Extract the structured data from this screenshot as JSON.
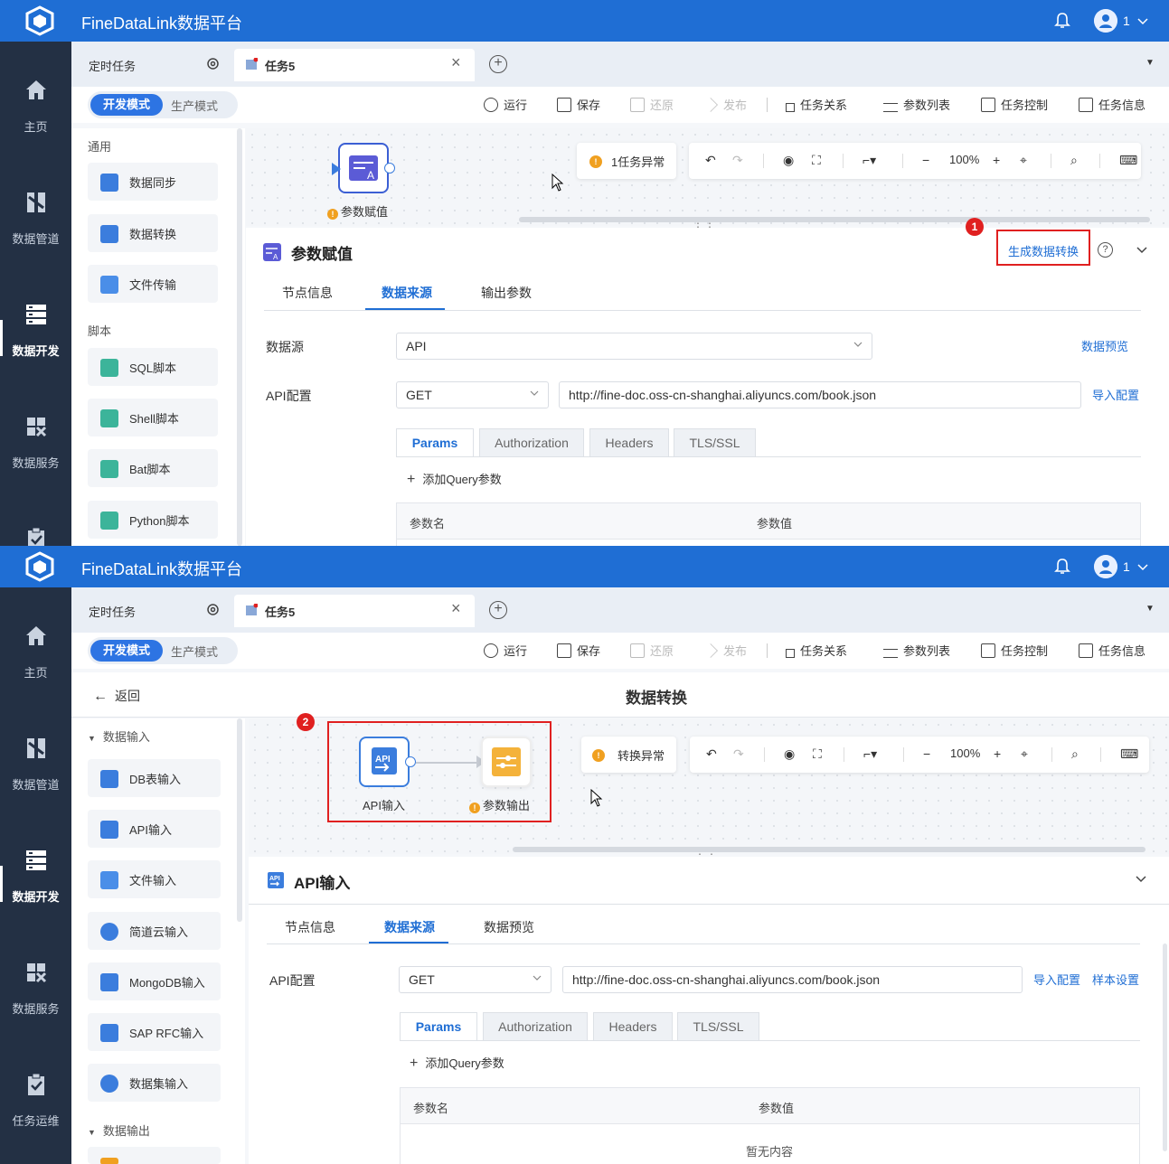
{
  "app": {
    "title": "FineDataLink数据平台",
    "user_name": "1"
  },
  "nav": [
    {
      "label": "主页",
      "icon": "home-icon"
    },
    {
      "label": "数据管道",
      "icon": "pipeline-icon"
    },
    {
      "label": "数据开发",
      "icon": "server-icon"
    },
    {
      "label": "数据服务",
      "icon": "service-icon"
    },
    {
      "label": "任务运维",
      "icon": "clipboard-icon"
    }
  ],
  "tabs": {
    "scheduled": "定时任务",
    "task": "任务5"
  },
  "modes": {
    "dev": "开发模式",
    "prod": "生产模式"
  },
  "toolbar": {
    "run": "运行",
    "save": "保存",
    "restore": "还原",
    "publish": "发布",
    "relations": "任务关系",
    "params": "参数列表",
    "control": "任务控制",
    "info": "任务信息"
  },
  "shotA": {
    "palette": {
      "sec_general": "通用",
      "general": [
        "数据同步",
        "数据转换",
        "文件传输"
      ],
      "sec_script": "脚本",
      "scripts": [
        "SQL脚本",
        "Shell脚本",
        "Bat脚本",
        "Python脚本"
      ]
    },
    "canvas": {
      "node_label": "参数赋值",
      "error_text": "1任务异常",
      "zoom": "100%"
    },
    "panel": {
      "title": "参数赋值",
      "generate_link": "生成数据转换",
      "tabs": [
        "节点信息",
        "数据来源",
        "输出参数"
      ],
      "datasource_label": "数据源",
      "datasource_value": "API",
      "preview_link": "数据预览",
      "api_label": "API配置",
      "method": "GET",
      "url": "http://fine-doc.oss-cn-shanghai.aliyuncs.com/book.json",
      "import_link": "导入配置",
      "subtabs": [
        "Params",
        "Authorization",
        "Headers",
        "TLS/SSL"
      ],
      "add_query": "添加Query参数",
      "col_name": "参数名",
      "col_value": "参数值"
    },
    "badge": "1"
  },
  "shotB": {
    "back": "返回",
    "canvas_title": "数据转换",
    "palette": {
      "sec_input": "数据输入",
      "inputs": [
        "DB表输入",
        "API输入",
        "文件输入",
        "简道云输入",
        "MongoDB输入",
        "SAP RFC输入",
        "数据集输入"
      ],
      "sec_output": "数据输出"
    },
    "canvas": {
      "node1_label": "API输入",
      "node2_label": "参数输出",
      "error_text": "转换异常",
      "zoom": "100%"
    },
    "panel": {
      "title": "API输入",
      "tabs": [
        "节点信息",
        "数据来源",
        "数据预览"
      ],
      "api_label": "API配置",
      "method": "GET",
      "url": "http://fine-doc.oss-cn-shanghai.aliyuncs.com/book.json",
      "import_link": "导入配置",
      "sample_link": "样本设置",
      "subtabs": [
        "Params",
        "Authorization",
        "Headers",
        "TLS/SSL"
      ],
      "add_query": "添加Query参数",
      "col_name": "参数名",
      "col_value": "参数值",
      "empty": "暂无内容"
    },
    "badge": "2"
  },
  "colors": {
    "primary": "#1f6ed4",
    "nav_bg": "#233044",
    "highlight": "#e02020",
    "warning": "#f0a020"
  }
}
